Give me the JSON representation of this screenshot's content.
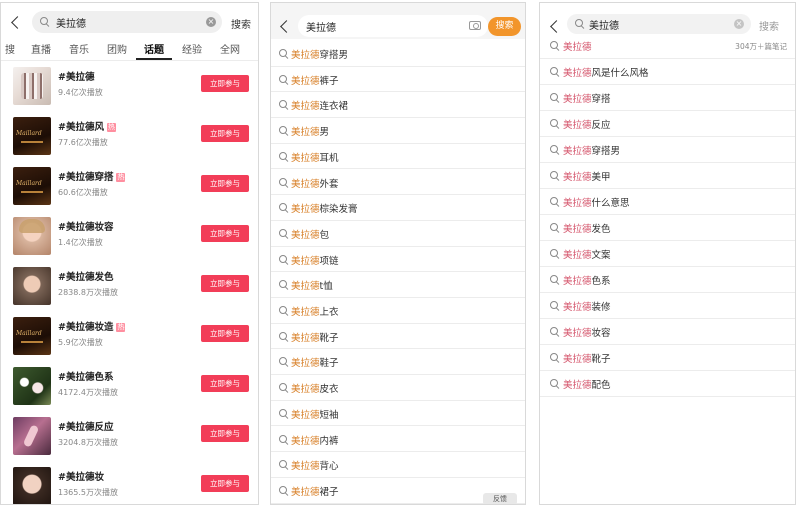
{
  "panel1": {
    "search": {
      "query": "美拉德",
      "button": "搜索"
    },
    "tabs": [
      "搜",
      "直播",
      "音乐",
      "团购",
      "话题",
      "经验",
      "全网"
    ],
    "active_tab": "话题",
    "topics": [
      {
        "name": "#美拉德",
        "plays": "9.4亿次播放",
        "hot": "",
        "thumb": "nails"
      },
      {
        "name": "#美拉德风",
        "plays": "77.6亿次播放",
        "hot": "热",
        "thumb": "dark"
      },
      {
        "name": "#美拉德穿搭",
        "plays": "60.6亿次播放",
        "hot": "热",
        "thumb": "dark"
      },
      {
        "name": "#美拉德妆容",
        "plays": "1.4亿次播放",
        "hot": "",
        "thumb": "face"
      },
      {
        "name": "#美拉德发色",
        "plays": "2838.8万次播放",
        "hot": "",
        "thumb": "face2"
      },
      {
        "name": "#美拉德妆造",
        "plays": "5.9亿次播放",
        "hot": "热",
        "thumb": "dark"
      },
      {
        "name": "#美拉德色系",
        "plays": "4172.4万次播放",
        "hot": "",
        "thumb": "flower"
      },
      {
        "name": "#美拉德反应",
        "plays": "3204.8万次播放",
        "hot": "",
        "thumb": "purple"
      },
      {
        "name": "#美拉德妆",
        "plays": "1365.5万次播放",
        "hot": "",
        "thumb": "face3"
      }
    ],
    "join_label": "立即参与"
  },
  "panel2": {
    "search": {
      "query": "美拉德",
      "button": "搜索",
      "camera_icon": "camera-icon"
    },
    "keyword": "美拉德",
    "suggestions": [
      "穿搭男",
      "裤子",
      "连衣裙",
      "男",
      "耳机",
      "外套",
      "棕染发膏",
      "包",
      "项链",
      "t恤",
      "上衣",
      "靴子",
      "鞋子",
      "皮衣",
      "短袖",
      "内裤",
      "背心",
      "裙子"
    ],
    "feedback": "反馈"
  },
  "panel3": {
    "search": {
      "query": "美拉德",
      "button": "搜索"
    },
    "keyword": "美拉德",
    "suggestions": [
      "",
      "风是什么风格",
      "穿搭",
      "反应",
      "穿搭男",
      "美甲",
      "什么意思",
      "发色",
      "文案",
      "色系",
      "装修",
      "妆容",
      "靴子",
      "配色"
    ],
    "first_count": "304万＋篇笔记"
  },
  "colors": {
    "join_button": "#f23d58",
    "highlight_orange": "#d77d23",
    "highlight_red": "#d4536a",
    "search_button": "#f2952b"
  }
}
